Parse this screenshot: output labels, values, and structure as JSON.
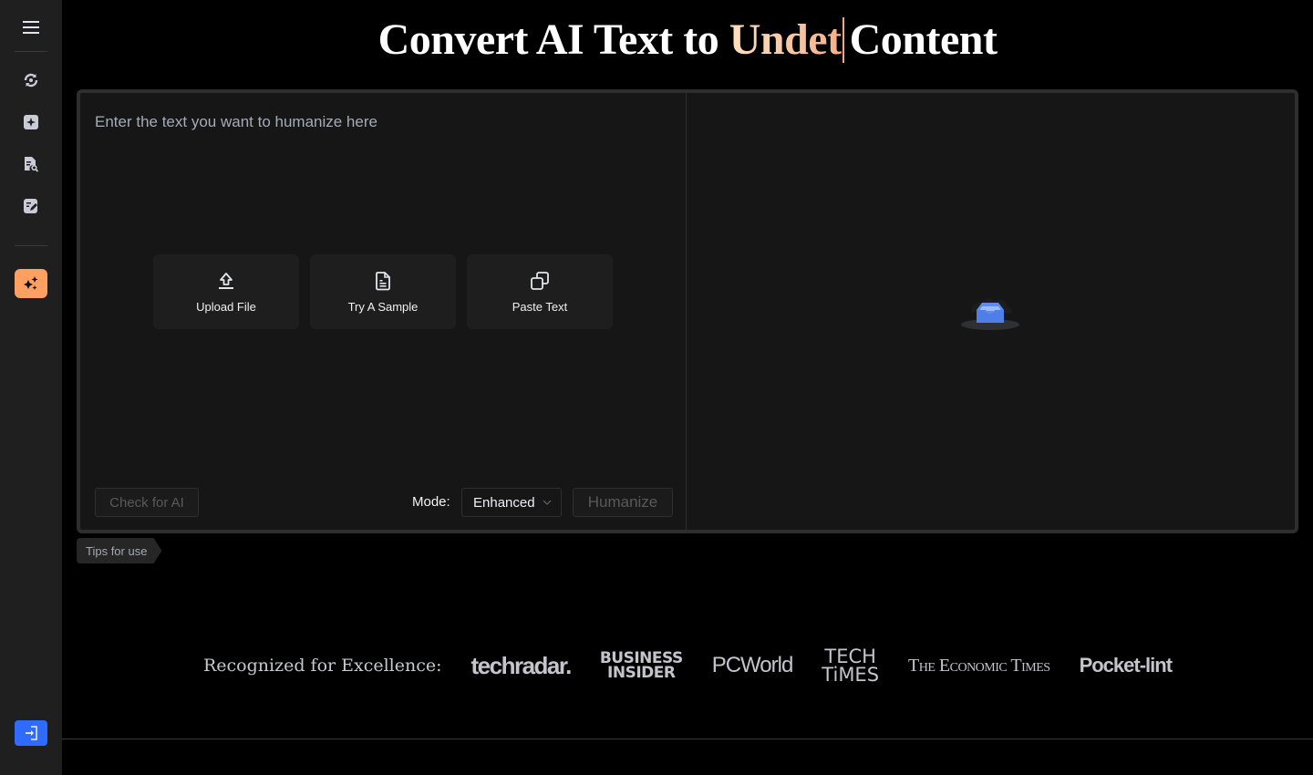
{
  "sidebar": {
    "menu_icon": "hamburger-menu-icon",
    "items": [
      {
        "name": "rewrite",
        "icon": "refresh-icon"
      },
      {
        "name": "generate",
        "icon": "plus-sparkle-icon"
      },
      {
        "name": "detector",
        "icon": "document-search-icon"
      },
      {
        "name": "editor",
        "icon": "edit-note-icon"
      }
    ],
    "active_item": {
      "name": "humanizer",
      "icon": "sparkles-icon",
      "color": "#fda061"
    },
    "login": {
      "icon": "login-icon",
      "color": "#2f6bff"
    }
  },
  "header": {
    "title_prefix": "Convert AI Text to",
    "title_highlight": "Undet",
    "title_suffix": "Content"
  },
  "editor": {
    "placeholder": "Enter the text you want to humanize here",
    "actions": [
      {
        "label": "Upload File",
        "icon": "upload-icon"
      },
      {
        "label": "Try A Sample",
        "icon": "document-icon"
      },
      {
        "label": "Paste Text",
        "icon": "copy-icon"
      }
    ],
    "check_label": "Check for AI",
    "mode_label": "Mode:",
    "mode_value": "Enhanced",
    "humanize_label": "Humanize"
  },
  "output": {
    "empty_icon": "empty-inbox-icon"
  },
  "tips_label": "Tips for use",
  "recognition": {
    "label": "Recognized for Excellence:",
    "logos": [
      {
        "name": "techradar",
        "text": "techradar."
      },
      {
        "name": "business-insider",
        "line1": "BUSINESS",
        "line2": "INSIDER"
      },
      {
        "name": "pcworld",
        "text": "PCWorld"
      },
      {
        "name": "tech-times",
        "line1": "TECH",
        "line2": "TiMES"
      },
      {
        "name": "economic-times",
        "text": "The Economic Times"
      },
      {
        "name": "pocket-lint",
        "text": "Pocket-lint"
      }
    ]
  },
  "colors": {
    "accent_orange": "#fda061",
    "accent_blue": "#2f6bff",
    "title_highlight_start": "#ffe0bd",
    "title_highlight_end": "#f4b08a"
  }
}
